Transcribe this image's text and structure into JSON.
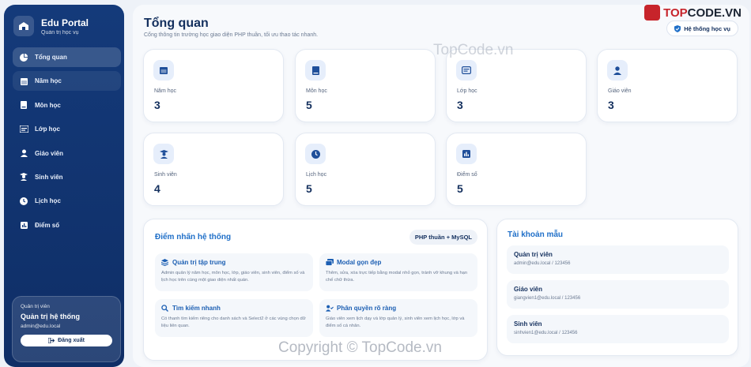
{
  "sidebar": {
    "brand_name": "Edu Portal",
    "brand_sub": "Quản trị học vụ",
    "items": [
      {
        "label": "Tổng quan",
        "icon": "pie-chart-icon"
      },
      {
        "label": "Năm học",
        "icon": "calendar-icon"
      },
      {
        "label": "Môn học",
        "icon": "book-icon"
      },
      {
        "label": "Lớp học",
        "icon": "id-card-icon"
      },
      {
        "label": "Giáo viên",
        "icon": "user-icon"
      },
      {
        "label": "Sinh viên",
        "icon": "graduate-icon"
      },
      {
        "label": "Lịch học",
        "icon": "clock-icon"
      },
      {
        "label": "Điểm số",
        "icon": "bar-chart-icon"
      }
    ],
    "user": {
      "role": "Quản trị viên",
      "name": "Quản trị hệ thống",
      "email": "admin@edu.local",
      "logout_label": "Đăng xuất"
    }
  },
  "header": {
    "title": "Tổng quan",
    "subtitle": "Cổng thông tin trường học giao diện PHP thuần, tối ưu thao tác nhanh.",
    "badge": "Hệ thống học vụ"
  },
  "stats": [
    {
      "label": "Năm học",
      "value": "3",
      "icon": "calendar-icon"
    },
    {
      "label": "Môn học",
      "value": "5",
      "icon": "book-icon"
    },
    {
      "label": "Lớp học",
      "value": "3",
      "icon": "id-card-icon"
    },
    {
      "label": "Giáo viên",
      "value": "3",
      "icon": "user-icon"
    },
    {
      "label": "Sinh viên",
      "value": "4",
      "icon": "graduate-icon"
    },
    {
      "label": "Lịch học",
      "value": "5",
      "icon": "clock-icon"
    },
    {
      "label": "Điểm số",
      "value": "5",
      "icon": "bar-chart-icon"
    }
  ],
  "highlights": {
    "title": "Điểm nhấn hệ thống",
    "badge": "PHP thuần + MySQL",
    "features": [
      {
        "title": "Quản trị tập trung",
        "desc": "Admin quản lý năm học, môn học, lớp, giáo viên, sinh viên, điểm số và lịch học trên cùng một giao diện nhất quán.",
        "icon": "layers-icon"
      },
      {
        "title": "Modal gọn đẹp",
        "desc": "Thêm, sửa, xóa trực tiếp bằng modal nhỏ gọn, tránh vỡ khung và hạn chế chữ thừa.",
        "icon": "window-icon"
      },
      {
        "title": "Tìm kiếm nhanh",
        "desc": "Có thanh tìm kiếm riêng cho danh sách và Select2 ở các vùng chọn dữ liệu liên quan.",
        "icon": "search-icon"
      },
      {
        "title": "Phân quyền rõ ràng",
        "desc": "Giáo viên xem lịch dạy và lớp quản lý, sinh viên xem lịch học, lớp và điểm số cá nhân.",
        "icon": "users-icon"
      }
    ]
  },
  "accounts": {
    "title": "Tài khoản mẫu",
    "items": [
      {
        "name": "Quản trị viên",
        "cred": "admin@edu.local / 123456"
      },
      {
        "name": "Giáo viên",
        "cred": "giangvien1@edu.local / 123456"
      },
      {
        "name": "Sinh viên",
        "cred": "sinhvien1@edu.local / 123456"
      }
    ]
  },
  "watermark": {
    "brand_prefix": "TOP",
    "brand_suffix": "CODE.VN",
    "site": "TopCode.vn",
    "copyright": "Copyright © TopCode.vn"
  },
  "colors": {
    "sidebar": "#143a7a",
    "accent": "#1f6fc8",
    "heading": "#14305e"
  }
}
